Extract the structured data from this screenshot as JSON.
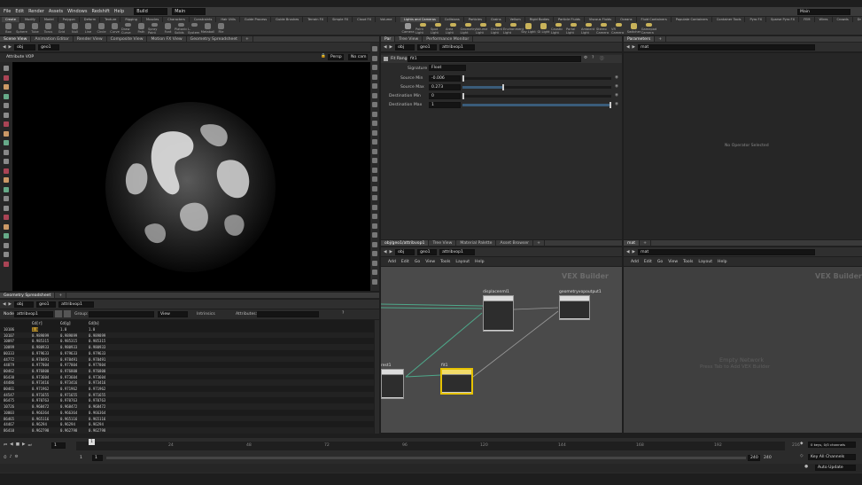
{
  "menubar": {
    "items": [
      "File",
      "Edit",
      "Render",
      "Assets",
      "Windows",
      "Redshift",
      "Help"
    ],
    "desktop": "Build",
    "context": "Main",
    "right_context": "Main"
  },
  "shelf_tabs_left": [
    "Create",
    "Modify",
    "Model",
    "Polygon",
    "Deform",
    "Texture",
    "Rigging",
    "Muscles",
    "Characters",
    "Constraints",
    "Hair Utils",
    "Guide Process",
    "Guide Brushes",
    "Terrain FX",
    "Simple FX",
    "Cloud FX",
    "Volume",
    "Redshift",
    "SideFX Labs"
  ],
  "shelf_tools_left": [
    "Box",
    "Sphere",
    "Tube",
    "Torus",
    "Grid",
    "Null",
    "Line",
    "Circle",
    "Curve",
    "Draw Curve",
    "Path",
    "Spray Paint",
    "Font",
    "Platonic Solids",
    "L-System",
    "Metaball",
    "File"
  ],
  "shelf_tabs_right": [
    "Lights and Cameras",
    "Collisions",
    "Particles",
    "Grains",
    "Vellum",
    "Rigid Bodies",
    "Particle Fluids",
    "Viscous Fluids",
    "Oceans",
    "Fluid Containers",
    "Populate Containers",
    "Container Tools",
    "Pyro FX",
    "Sparse Pyro FX",
    "FEM",
    "Wires",
    "Crowds",
    "Drive Simulation"
  ],
  "shelf_tools_right": [
    "Camera",
    "Point Light",
    "Spot Light",
    "Area Light",
    "Geometry Light",
    "Volume Light",
    "Distant Light",
    "Environment Light",
    "Sky Light",
    "GI Light",
    "Caustic Light",
    "Portal Light",
    "Ambient Light",
    "Stereo Camera",
    "VR Camera",
    "Switcher",
    "Gamepad Camera"
  ],
  "left_panel": {
    "tabs": [
      "Scene View",
      "Animation Editor",
      "Render View",
      "Composite View",
      "Motion FX View",
      "Geometry Spreadsheet"
    ],
    "path": [
      "obj",
      "geo1"
    ],
    "viewport_label": "Attribute VOP",
    "persp": "Persp",
    "cam": "No cam"
  },
  "spreadsheet": {
    "tabs": [
      "Geometry Spreadsheet"
    ],
    "path": [
      "obj",
      "geo1",
      "attribvop1"
    ],
    "node_label": "Node:",
    "node_value": "attribvop1",
    "group_label": "Group:",
    "view_label": "View",
    "intrinsics_label": "Intrinsics",
    "attributes_label": "Attributes:",
    "headers": [
      "",
      "Cd[r]",
      "Cd[g]",
      "Cd[b]"
    ],
    "rows": [
      [
        "10106",
        "1.0",
        "1.0",
        "1.0"
      ],
      [
        "10107",
        "0.989899",
        "0.989899",
        "0.989899"
      ],
      [
        "10097",
        "0.985315",
        "0.985315",
        "0.985315"
      ],
      [
        "10099",
        "0.980933",
        "0.980933",
        "0.980933"
      ],
      [
        "00333",
        "0.979633",
        "0.979633",
        "0.979633"
      ],
      [
        "44772",
        "0.978491",
        "0.978491",
        "0.978491"
      ],
      [
        "44879",
        "0.977804",
        "0.977804",
        "0.977804"
      ],
      [
        "00462",
        "0.976800",
        "0.976800",
        "0.976800"
      ],
      [
        "86430",
        "0.973604",
        "0.973604",
        "0.973604"
      ],
      [
        "44486",
        "0.973416",
        "0.973416",
        "0.973416"
      ],
      [
        "00461",
        "0.971962",
        "0.971962",
        "0.971962"
      ],
      [
        "44547",
        "0.971655",
        "0.971655",
        "0.971655"
      ],
      [
        "86475",
        "0.970763",
        "0.970763",
        "0.970763"
      ],
      [
        "10726",
        "0.968472",
        "0.968472",
        "0.968472"
      ],
      [
        "10003",
        "0.966364",
        "0.966364",
        "0.966364"
      ],
      [
        "86465",
        "0.965116",
        "0.965116",
        "0.965116"
      ],
      [
        "44467",
        "0.96294",
        "0.96294",
        "0.96294"
      ],
      [
        "86410",
        "0.962798",
        "0.962798",
        "0.962798"
      ]
    ]
  },
  "params": {
    "tabs": [
      "Tree View",
      "Performance Monitor"
    ],
    "path": [
      "obj",
      "geo1",
      "attribvop1"
    ],
    "node_type": "Fit Range",
    "node_name": "fit1",
    "signature_label": "Signature",
    "signature_value": "Float",
    "rows": [
      {
        "label": "Source Min",
        "value": "-0.006",
        "fill": 0.0
      },
      {
        "label": "Source Max",
        "value": "0.273",
        "fill": 0.27
      },
      {
        "label": "Destination Min",
        "value": "0",
        "fill": 0.0
      },
      {
        "label": "Destination Max",
        "value": "1",
        "fill": 1.0
      }
    ]
  },
  "right_params": {
    "tab": "Parameters",
    "path": "mat",
    "message": "No Operator Selected"
  },
  "network": {
    "tabs": [
      "obj/geo1/attribvop1",
      "Tree View",
      "Material Palette",
      "Asset Browser"
    ],
    "path": [
      "obj",
      "geo1",
      "attribvop1"
    ],
    "menus": [
      "Add",
      "Edit",
      "Go",
      "View",
      "Tools",
      "Layout",
      "Help"
    ],
    "title": "VEX Builder",
    "nodes": [
      "displacenml1",
      "geometryvopoutput1",
      "rest1",
      "fit1"
    ]
  },
  "mat_network": {
    "tab": "mat",
    "path": "mat",
    "menus": [
      "Add",
      "Edit",
      "Go",
      "View",
      "Tools",
      "Layout",
      "Help"
    ],
    "title": "VEX Builder",
    "empty_title": "Empty Network",
    "empty_hint": "Press Tab to Add VEX Builder"
  },
  "timeline": {
    "frame": "1",
    "current": "1",
    "start": "1",
    "end": "240",
    "end2": "240",
    "ticks": [
      "24",
      "48",
      "72",
      "96",
      "120",
      "144",
      "168",
      "192",
      "216"
    ],
    "keys_label": "0 keys, 0/0 channels",
    "key_all": "Key All Channels",
    "auto_update": "Auto Update"
  }
}
